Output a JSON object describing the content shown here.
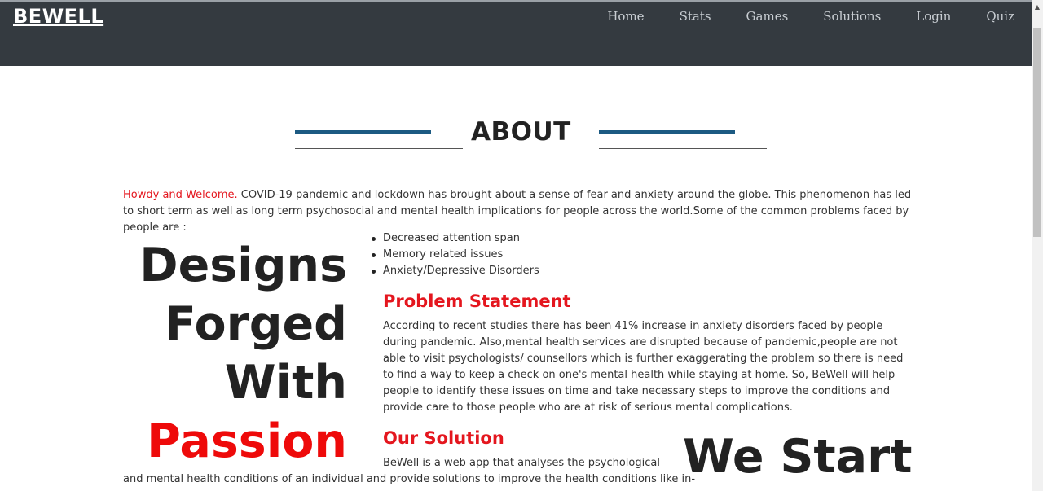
{
  "brand": "BEWELL",
  "nav": [
    "Home",
    "Stats",
    "Games",
    "Solutions",
    "Login",
    "Quiz"
  ],
  "about": {
    "title": "ABOUT"
  },
  "intro": {
    "greeting": "Howdy and Welcome.",
    "text": " COVID-19 pandemic and lockdown has brought about a sense of fear and anxiety around the globe. This phenomenon has led to short term as well as long term psychosocial and mental health implications for people across the world.Some of the common problems faced by people are :"
  },
  "tagline": {
    "line1": "Designs",
    "line2": "Forged",
    "line3": "With",
    "line4": "Passion"
  },
  "problems": [
    "Decreased attention span",
    "Memory related issues",
    "Anxiety/Depressive Disorders"
  ],
  "problem_statement": {
    "heading": "Problem Statement",
    "text": "According to recent studies there has been 41% increase in anxiety disorders faced by people during pandemic. Also,mental health services are disrupted because of pandemic,people are not able to visit psychologists/ counsellors which is further exaggerating the problem so there is need to find a way to keep a check on one's mental health while staying at home. So, BeWell will help people to identify these issues on time and take necessary steps to improve the conditions and provide care to those people who are at risk of serious mental complications."
  },
  "solution": {
    "heading": "Our Solution",
    "line1": "BeWell is a web app that analyses the psychological",
    "line2": "and mental health conditions of an individual and provide solutions to improve the health conditions like in-"
  },
  "we_start": "We Start",
  "colors": {
    "navbar": "#343a40",
    "accent_red": "#e4161e",
    "rule_blue": "#1c5a82"
  }
}
